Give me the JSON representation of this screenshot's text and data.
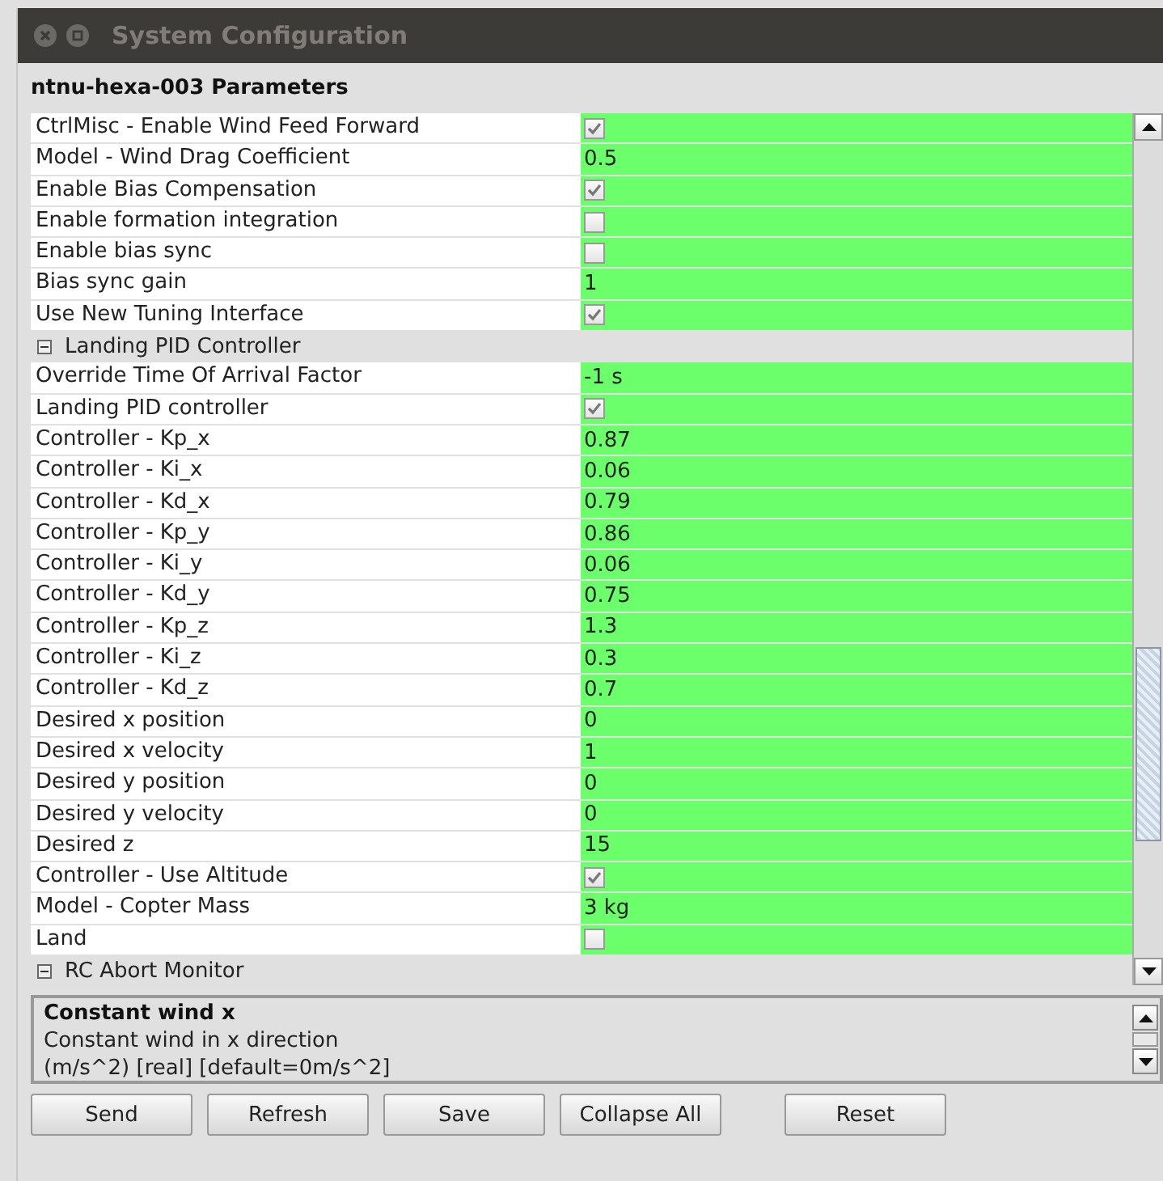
{
  "window": {
    "title": "System Configuration"
  },
  "heading": "ntnu-hexa-003 Parameters",
  "rows": [
    {
      "kind": "bool",
      "name": "CtrlMisc - Enable Wind Feed Forward",
      "checked": true
    },
    {
      "kind": "value",
      "name": "Model - Wind Drag Coefficient",
      "value": "0.5"
    },
    {
      "kind": "bool",
      "name": "Enable Bias Compensation",
      "checked": true
    },
    {
      "kind": "bool",
      "name": "Enable formation integration",
      "checked": false
    },
    {
      "kind": "bool",
      "name": "Enable bias sync",
      "checked": false
    },
    {
      "kind": "value",
      "name": "Bias sync gain",
      "value": "1"
    },
    {
      "kind": "bool",
      "name": "Use New Tuning Interface",
      "checked": true
    },
    {
      "kind": "group",
      "name": "Landing PID Controller",
      "expanded": true
    },
    {
      "kind": "value",
      "name": "Override Time Of Arrival Factor",
      "value": "-1 s"
    },
    {
      "kind": "bool",
      "name": "Landing PID controller",
      "checked": true
    },
    {
      "kind": "value",
      "name": "Controller - Kp_x",
      "value": "0.87"
    },
    {
      "kind": "value",
      "name": "Controller - Ki_x",
      "value": "0.06"
    },
    {
      "kind": "value",
      "name": "Controller - Kd_x",
      "value": "0.79"
    },
    {
      "kind": "value",
      "name": "Controller - Kp_y",
      "value": "0.86"
    },
    {
      "kind": "value",
      "name": "Controller - Ki_y",
      "value": "0.06"
    },
    {
      "kind": "value",
      "name": "Controller - Kd_y",
      "value": "0.75"
    },
    {
      "kind": "value",
      "name": "Controller - Kp_z",
      "value": "1.3"
    },
    {
      "kind": "value",
      "name": "Controller - Ki_z",
      "value": "0.3"
    },
    {
      "kind": "value",
      "name": "Controller - Kd_z",
      "value": "0.7"
    },
    {
      "kind": "value",
      "name": "Desired x position",
      "value": "0"
    },
    {
      "kind": "value",
      "name": "Desired x velocity",
      "value": "1"
    },
    {
      "kind": "value",
      "name": "Desired y position",
      "value": "0"
    },
    {
      "kind": "value",
      "name": "Desired y velocity",
      "value": "0"
    },
    {
      "kind": "value",
      "name": "Desired z",
      "value": "15"
    },
    {
      "kind": "bool",
      "name": "Controller - Use Altitude",
      "checked": true
    },
    {
      "kind": "value",
      "name": "Model - Copter Mass",
      "value": "3 kg"
    },
    {
      "kind": "bool",
      "name": "Land",
      "checked": false
    },
    {
      "kind": "group",
      "name": "RC Abort Monitor",
      "expanded": true
    }
  ],
  "description": {
    "title": "Constant wind x",
    "lines": [
      "Constant wind in x direction",
      "(m/s^2) [real] [default=0m/s^2]"
    ]
  },
  "buttons": [
    "Send",
    "Refresh",
    "Save",
    "Collapse All",
    "Reset"
  ]
}
